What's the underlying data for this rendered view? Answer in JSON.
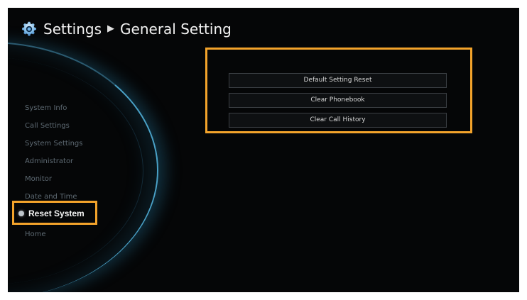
{
  "header": {
    "icon": "gear-icon",
    "title": "Settings",
    "separator_icon": "triangle-right-icon",
    "separator": "▶",
    "subtitle": "General Setting"
  },
  "sidebar": {
    "items": [
      {
        "label": "System Info"
      },
      {
        "label": "Call Settings"
      },
      {
        "label": "System Settings"
      },
      {
        "label": "Administrator"
      },
      {
        "label": "Monitor"
      },
      {
        "label": "Date and Time"
      },
      {
        "label": "Reset System",
        "selected": true
      },
      {
        "label": "Home"
      }
    ],
    "selected_index": 6
  },
  "actions": [
    {
      "label": "Default Setting Reset"
    },
    {
      "label": "Clear Phonebook"
    },
    {
      "label": "Clear Call History"
    }
  ],
  "colors": {
    "background": "#050607",
    "highlight_border": "#f3a32b",
    "menu_text": "#5e6a73",
    "selected_text": "#f5f5f5",
    "glow": "#4aa2c8"
  }
}
